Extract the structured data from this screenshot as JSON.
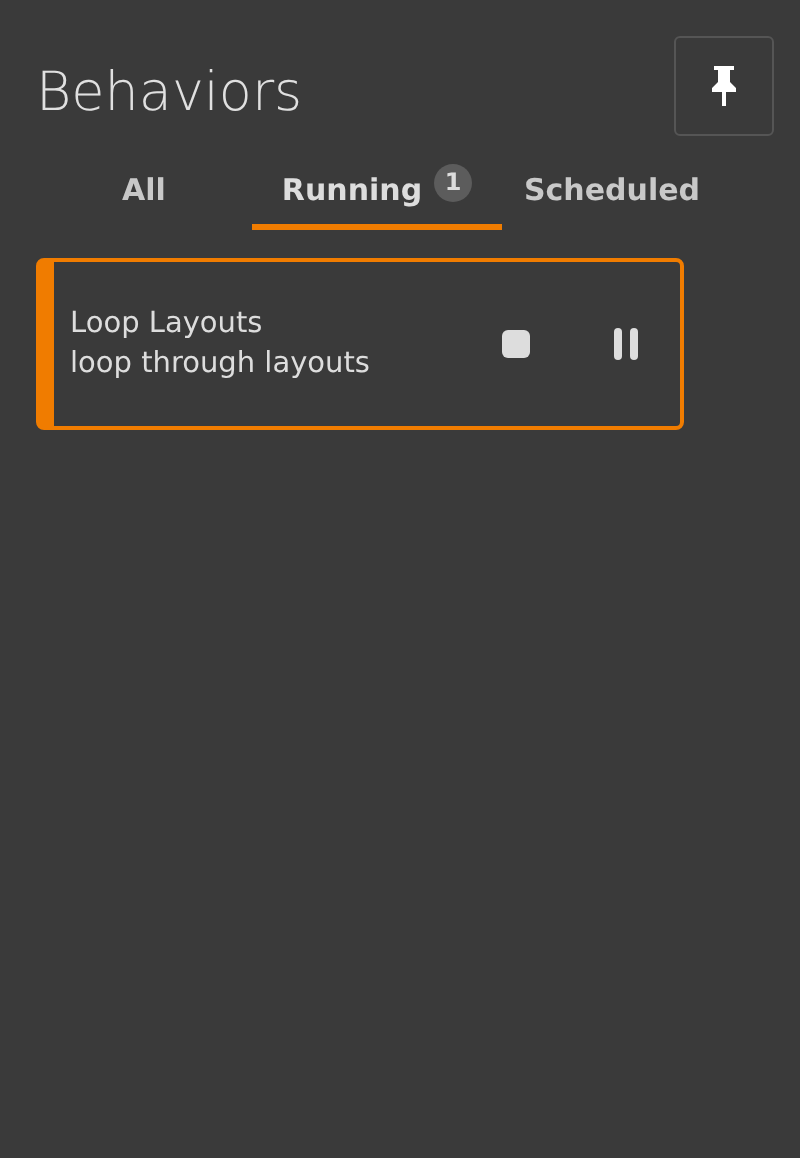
{
  "title": "Behaviors",
  "tabs": [
    {
      "label": "All",
      "selected": false
    },
    {
      "label": "Running",
      "selected": true,
      "badge": "1"
    },
    {
      "label": "Scheduled",
      "selected": false
    }
  ],
  "behaviors": [
    {
      "name": "Loop Layouts",
      "description": "loop through layouts"
    }
  ]
}
